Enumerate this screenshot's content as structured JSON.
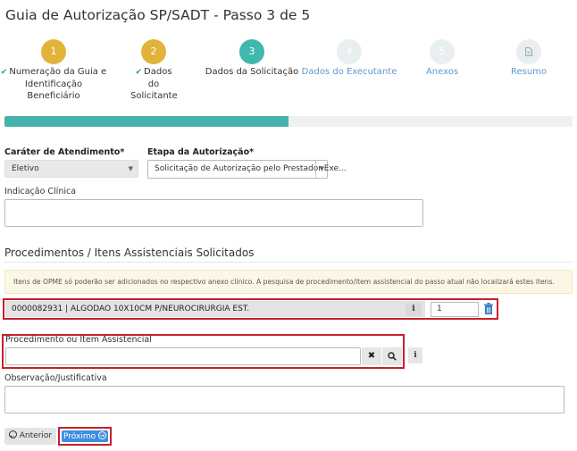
{
  "page": {
    "title": "Guia de Autorização SP/SADT - Passo 3 de 5"
  },
  "steps": [
    {
      "number": "1",
      "label": "Numeração da Guia e Identificação Beneficiário",
      "state": "done"
    },
    {
      "number": "2",
      "label": "Dados do Solicitante",
      "state": "done"
    },
    {
      "number": "3",
      "label": "Dados da Solicitação",
      "state": "active"
    },
    {
      "number": "4",
      "label": "Dados do Executante",
      "state": "todo"
    },
    {
      "number": "5",
      "label": "Anexos",
      "state": "todo"
    },
    {
      "number": "",
      "label": "Resumo",
      "state": "todo",
      "icon": "document-icon"
    }
  ],
  "progress": {
    "percent": 50
  },
  "form": {
    "carater": {
      "label": "Caráter de Atendimento*",
      "value": "Eletivo"
    },
    "etapa": {
      "label": "Etapa da Autorização*",
      "value": "Solicitação de Autorização pelo Prestador Exe..."
    },
    "indicacao": {
      "label": "Indicação Clínica",
      "value": ""
    }
  },
  "procedures": {
    "section_title": "Procedimentos / Itens Assistenciais Solicitados",
    "alert": "Itens de OPME só poderão ser adicionados no respectivo anexo clínico. A pesquisa de procedimento/item assistencial do passo atual não localizará estes itens.",
    "items": [
      {
        "text": "0000082931 | ALGODAO 10X10CM P/NEUROCIRURGIA EST.",
        "quantity": "1"
      }
    ],
    "search": {
      "label": "Procedimento ou Item Assistencial",
      "value": ""
    }
  },
  "observacao": {
    "label": "Observação/Justificativa",
    "value": ""
  },
  "buttons": {
    "prev": "Anterior",
    "next": "Próximo"
  },
  "colors": {
    "step_done": "#e1b33a",
    "step_active": "#3fb8ad",
    "progress": "#45b3ab",
    "primary": "#3e8de0",
    "highlight": "#c8202b"
  }
}
